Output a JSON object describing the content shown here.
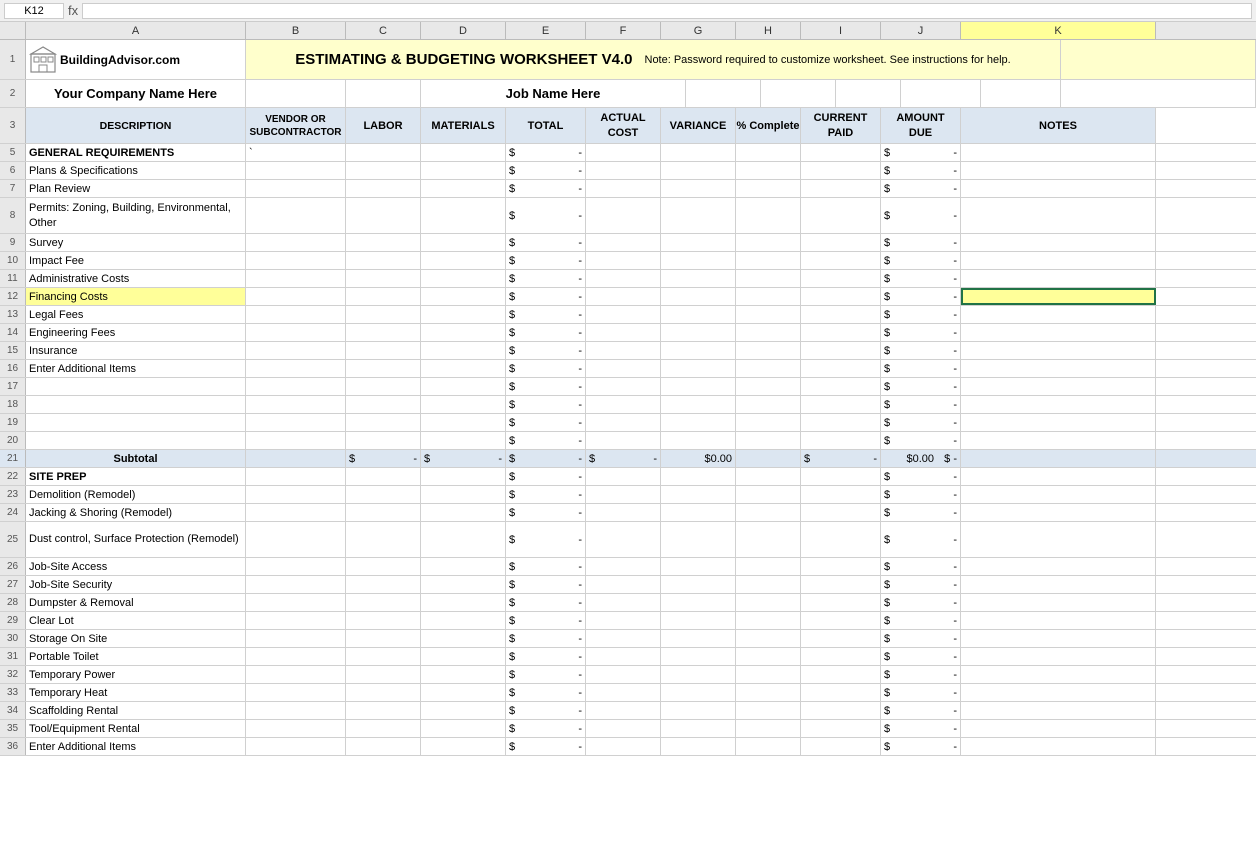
{
  "app": {
    "cell_ref": "K12",
    "formula_bar": ""
  },
  "col_headers": [
    "A",
    "B",
    "C",
    "D",
    "E",
    "F",
    "G",
    "H",
    "I",
    "J",
    "K"
  ],
  "col_widths_label": [
    "Description",
    "Vendor",
    "Labor",
    "Materials",
    "Total",
    "Actual Cost",
    "Variance",
    "% Complete",
    "Current Paid",
    "Amount Due",
    "Notes"
  ],
  "header": {
    "logo_text": "BuildingAdvisor.com",
    "title": "ESTIMATING &  BUDGETING WORKSHEET  V4.0",
    "note": "Note:  Password required to customize worksheet. See instructions for help.",
    "company_placeholder": "Your Company Name Here",
    "job_placeholder": "Job Name Here"
  },
  "column_headers": {
    "description": "DESCRIPTION",
    "vendor": "VENDOR OR SUBCONTRACTOR",
    "labor": "LABOR",
    "materials": "MATERIALS",
    "total": "TOTAL",
    "actual_cost": "ACTUAL COST",
    "variance": "VARIANCE",
    "pct_complete": "% Complete",
    "current_paid": "CURRENT PAID",
    "amount_due": "AMOUNT DUE",
    "notes": "NOTES"
  },
  "rows": [
    {
      "num": 5,
      "desc": "GENERAL REQUIREMENTS",
      "bold": true,
      "vendor": "`",
      "labor": "",
      "materials": "",
      "total": "$ -",
      "actual": "",
      "variance": "",
      "pct": "",
      "paid": "",
      "due": "$ -",
      "notes": ""
    },
    {
      "num": 6,
      "desc": "Plans & Specifications",
      "bold": false,
      "total": "$ -",
      "due": "$ -"
    },
    {
      "num": 7,
      "desc": "Plan Review",
      "bold": false,
      "total": "$ -",
      "due": "$ -"
    },
    {
      "num": 8,
      "desc": "Permits: Zoning, Building, Environmental, Other",
      "tall": true,
      "bold": false,
      "total": "$ -",
      "due": "$ -"
    },
    {
      "num": 9,
      "desc": "Survey",
      "bold": false,
      "total": "$ -",
      "due": "$ -"
    },
    {
      "num": 10,
      "desc": "Impact Fee",
      "bold": false,
      "total": "$ -",
      "due": "$ -"
    },
    {
      "num": 11,
      "desc": "Administrative Costs",
      "bold": false,
      "total": "$ -",
      "due": "$ -"
    },
    {
      "num": 12,
      "desc": "Financing Costs",
      "bold": false,
      "highlight": true,
      "total": "$ -",
      "due": "$ -"
    },
    {
      "num": 13,
      "desc": "Legal Fees",
      "bold": false,
      "total": "$ -",
      "due": "$ -"
    },
    {
      "num": 14,
      "desc": "Engineering Fees",
      "bold": false,
      "total": "$ -",
      "due": "$ -"
    },
    {
      "num": 15,
      "desc": "Insurance",
      "bold": false,
      "total": "$ -",
      "due": "$ -"
    },
    {
      "num": 16,
      "desc": "Enter Additional Items",
      "bold": false,
      "total": "$ -",
      "due": "$ -"
    },
    {
      "num": 17,
      "desc": "",
      "total": "$ -",
      "due": "$ -"
    },
    {
      "num": 18,
      "desc": "",
      "total": "$ -",
      "due": "$ -"
    },
    {
      "num": 19,
      "desc": "",
      "total": "$ -",
      "due": "$ -"
    },
    {
      "num": 20,
      "desc": "",
      "total": "$ -",
      "due": "$ -"
    },
    {
      "num": 21,
      "subtotal": true,
      "desc": "Subtotal",
      "labor": "$ -",
      "materials": "$ -",
      "total": "$ -",
      "actual": "$ -",
      "variance": "$0.00",
      "paid": "$ -",
      "paid2": "$0.00",
      "due": "$ -"
    },
    {
      "num": 22,
      "desc": "SITE PREP",
      "bold": true,
      "section": true,
      "total": "$ -",
      "due": "$ -"
    },
    {
      "num": 23,
      "desc": "Demolition (Remodel)",
      "total": "$ -",
      "due": "$ -"
    },
    {
      "num": 24,
      "desc": "Jacking & Shoring (Remodel)",
      "total": "$ -",
      "due": "$ -"
    },
    {
      "num": 25,
      "desc": "Dust control, Surface Protection (Remodel)",
      "tall": true,
      "total": "$ -",
      "due": "$ -"
    },
    {
      "num": 26,
      "desc": "Job-Site Access",
      "total": "$ -",
      "due": "$ -"
    },
    {
      "num": 27,
      "desc": "Job-Site Security",
      "total": "$ -",
      "due": "$ -"
    },
    {
      "num": 28,
      "desc": "Dumpster & Removal",
      "total": "$ -",
      "due": "$ -"
    },
    {
      "num": 29,
      "desc": "Clear Lot",
      "total": "$ -",
      "due": "$ -"
    },
    {
      "num": 30,
      "desc": "Storage On Site",
      "total": "$ -",
      "due": "$ -"
    },
    {
      "num": 31,
      "desc": "Portable Toilet",
      "total": "$ -",
      "due": "$ -"
    },
    {
      "num": 32,
      "desc": "Temporary Power",
      "total": "$ -",
      "due": "$ -"
    },
    {
      "num": 33,
      "desc": "Temporary Heat",
      "total": "$ -",
      "due": "$ -"
    },
    {
      "num": 34,
      "desc": "Scaffolding Rental",
      "total": "$ -",
      "due": "$ -"
    },
    {
      "num": 35,
      "desc": "Tool/Equipment Rental",
      "total": "$ -",
      "due": "$ -"
    },
    {
      "num": 36,
      "desc": "Enter Additional Items",
      "total": "$ -",
      "due": "$ -"
    }
  ]
}
